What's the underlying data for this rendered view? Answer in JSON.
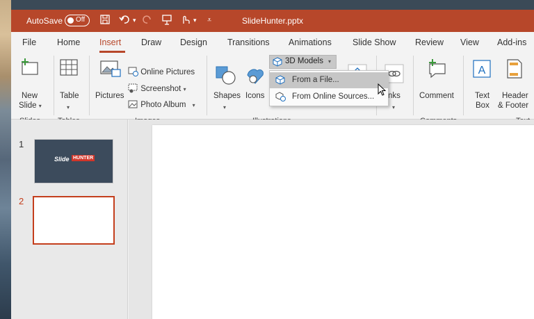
{
  "titlebar": {
    "autosave_label": "AutoSave",
    "autosave_state": "Off",
    "doc_title": "SlideHunter.pptx",
    "accent": "#b7472a"
  },
  "tabs": [
    {
      "label": "File"
    },
    {
      "label": "Home"
    },
    {
      "label": "Insert",
      "active": true
    },
    {
      "label": "Draw"
    },
    {
      "label": "Design"
    },
    {
      "label": "Transitions"
    },
    {
      "label": "Animations"
    },
    {
      "label": "Slide Show"
    },
    {
      "label": "Review"
    },
    {
      "label": "View"
    },
    {
      "label": "Add-ins"
    }
  ],
  "ribbon": {
    "new_slide": {
      "line1": "New",
      "line2": "Slide"
    },
    "table": {
      "label": "Table"
    },
    "pictures": {
      "label": "Pictures"
    },
    "online_pictures": {
      "label": "Online Pictures"
    },
    "screenshot": {
      "label": "Screenshot"
    },
    "photo_album": {
      "label": "Photo Album"
    },
    "shapes": {
      "label": "Shapes"
    },
    "icons": {
      "label": "Icons"
    },
    "models3d": {
      "label": "3D Models"
    },
    "links": {
      "label": "Links"
    },
    "comment": {
      "label": "Comment"
    },
    "textbox": {
      "line1": "Text",
      "line2": "Box"
    },
    "header_footer": {
      "line1": "Header",
      "line2": "& Footer"
    },
    "groups": {
      "slides": "Slides",
      "tables": "Tables",
      "images": "Images",
      "illustrations": "Illustrations",
      "comments": "Comments",
      "text": "Text"
    }
  },
  "menu3d": {
    "items": [
      {
        "label": "From a File...",
        "icon": "cube-icon",
        "hover": true
      },
      {
        "label": "From Online Sources...",
        "icon": "globe-cube-icon"
      }
    ]
  },
  "thumbnails": [
    {
      "number": "1",
      "logo_slide": "Slide",
      "logo_hunter": "HUNTER"
    },
    {
      "number": "2",
      "selected": true
    }
  ]
}
